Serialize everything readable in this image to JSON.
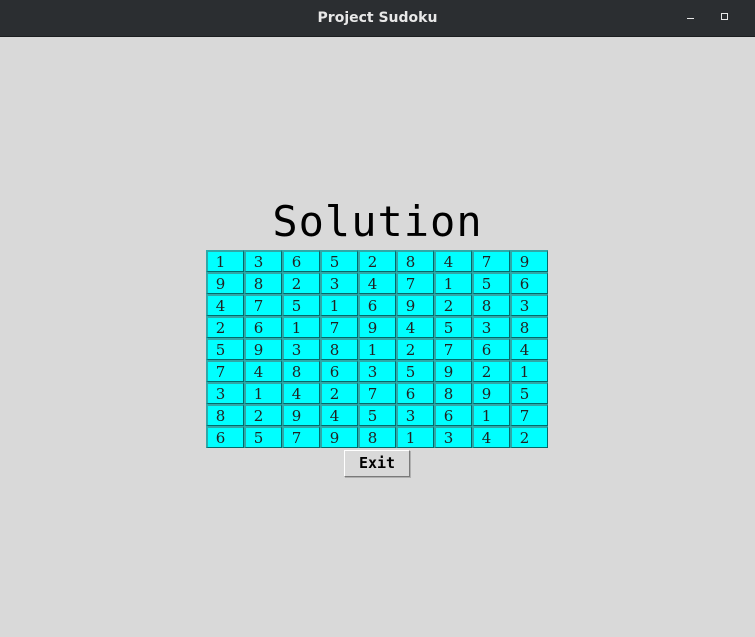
{
  "window": {
    "title": "Project Sudoku",
    "controls": {
      "minimize_icon": "minimize-icon",
      "maximize_icon": "maximize-icon"
    }
  },
  "heading": "Solution",
  "colors": {
    "background": "#d9d9d9",
    "cell_fill": "#00ffff",
    "titlebar": "#2b2e31"
  },
  "grid": [
    [
      "1",
      "3",
      "6",
      "5",
      "2",
      "8",
      "4",
      "7",
      "9"
    ],
    [
      "9",
      "8",
      "2",
      "3",
      "4",
      "7",
      "1",
      "5",
      "6"
    ],
    [
      "4",
      "7",
      "5",
      "1",
      "6",
      "9",
      "2",
      "8",
      "3"
    ],
    [
      "2",
      "6",
      "1",
      "7",
      "9",
      "4",
      "5",
      "3",
      "8"
    ],
    [
      "5",
      "9",
      "3",
      "8",
      "1",
      "2",
      "7",
      "6",
      "4"
    ],
    [
      "7",
      "4",
      "8",
      "6",
      "3",
      "5",
      "9",
      "2",
      "1"
    ],
    [
      "3",
      "1",
      "4",
      "2",
      "7",
      "6",
      "8",
      "9",
      "5"
    ],
    [
      "8",
      "2",
      "9",
      "4",
      "5",
      "3",
      "6",
      "1",
      "7"
    ],
    [
      "6",
      "5",
      "7",
      "9",
      "8",
      "1",
      "3",
      "4",
      "2"
    ]
  ],
  "exit_label": "Exit"
}
